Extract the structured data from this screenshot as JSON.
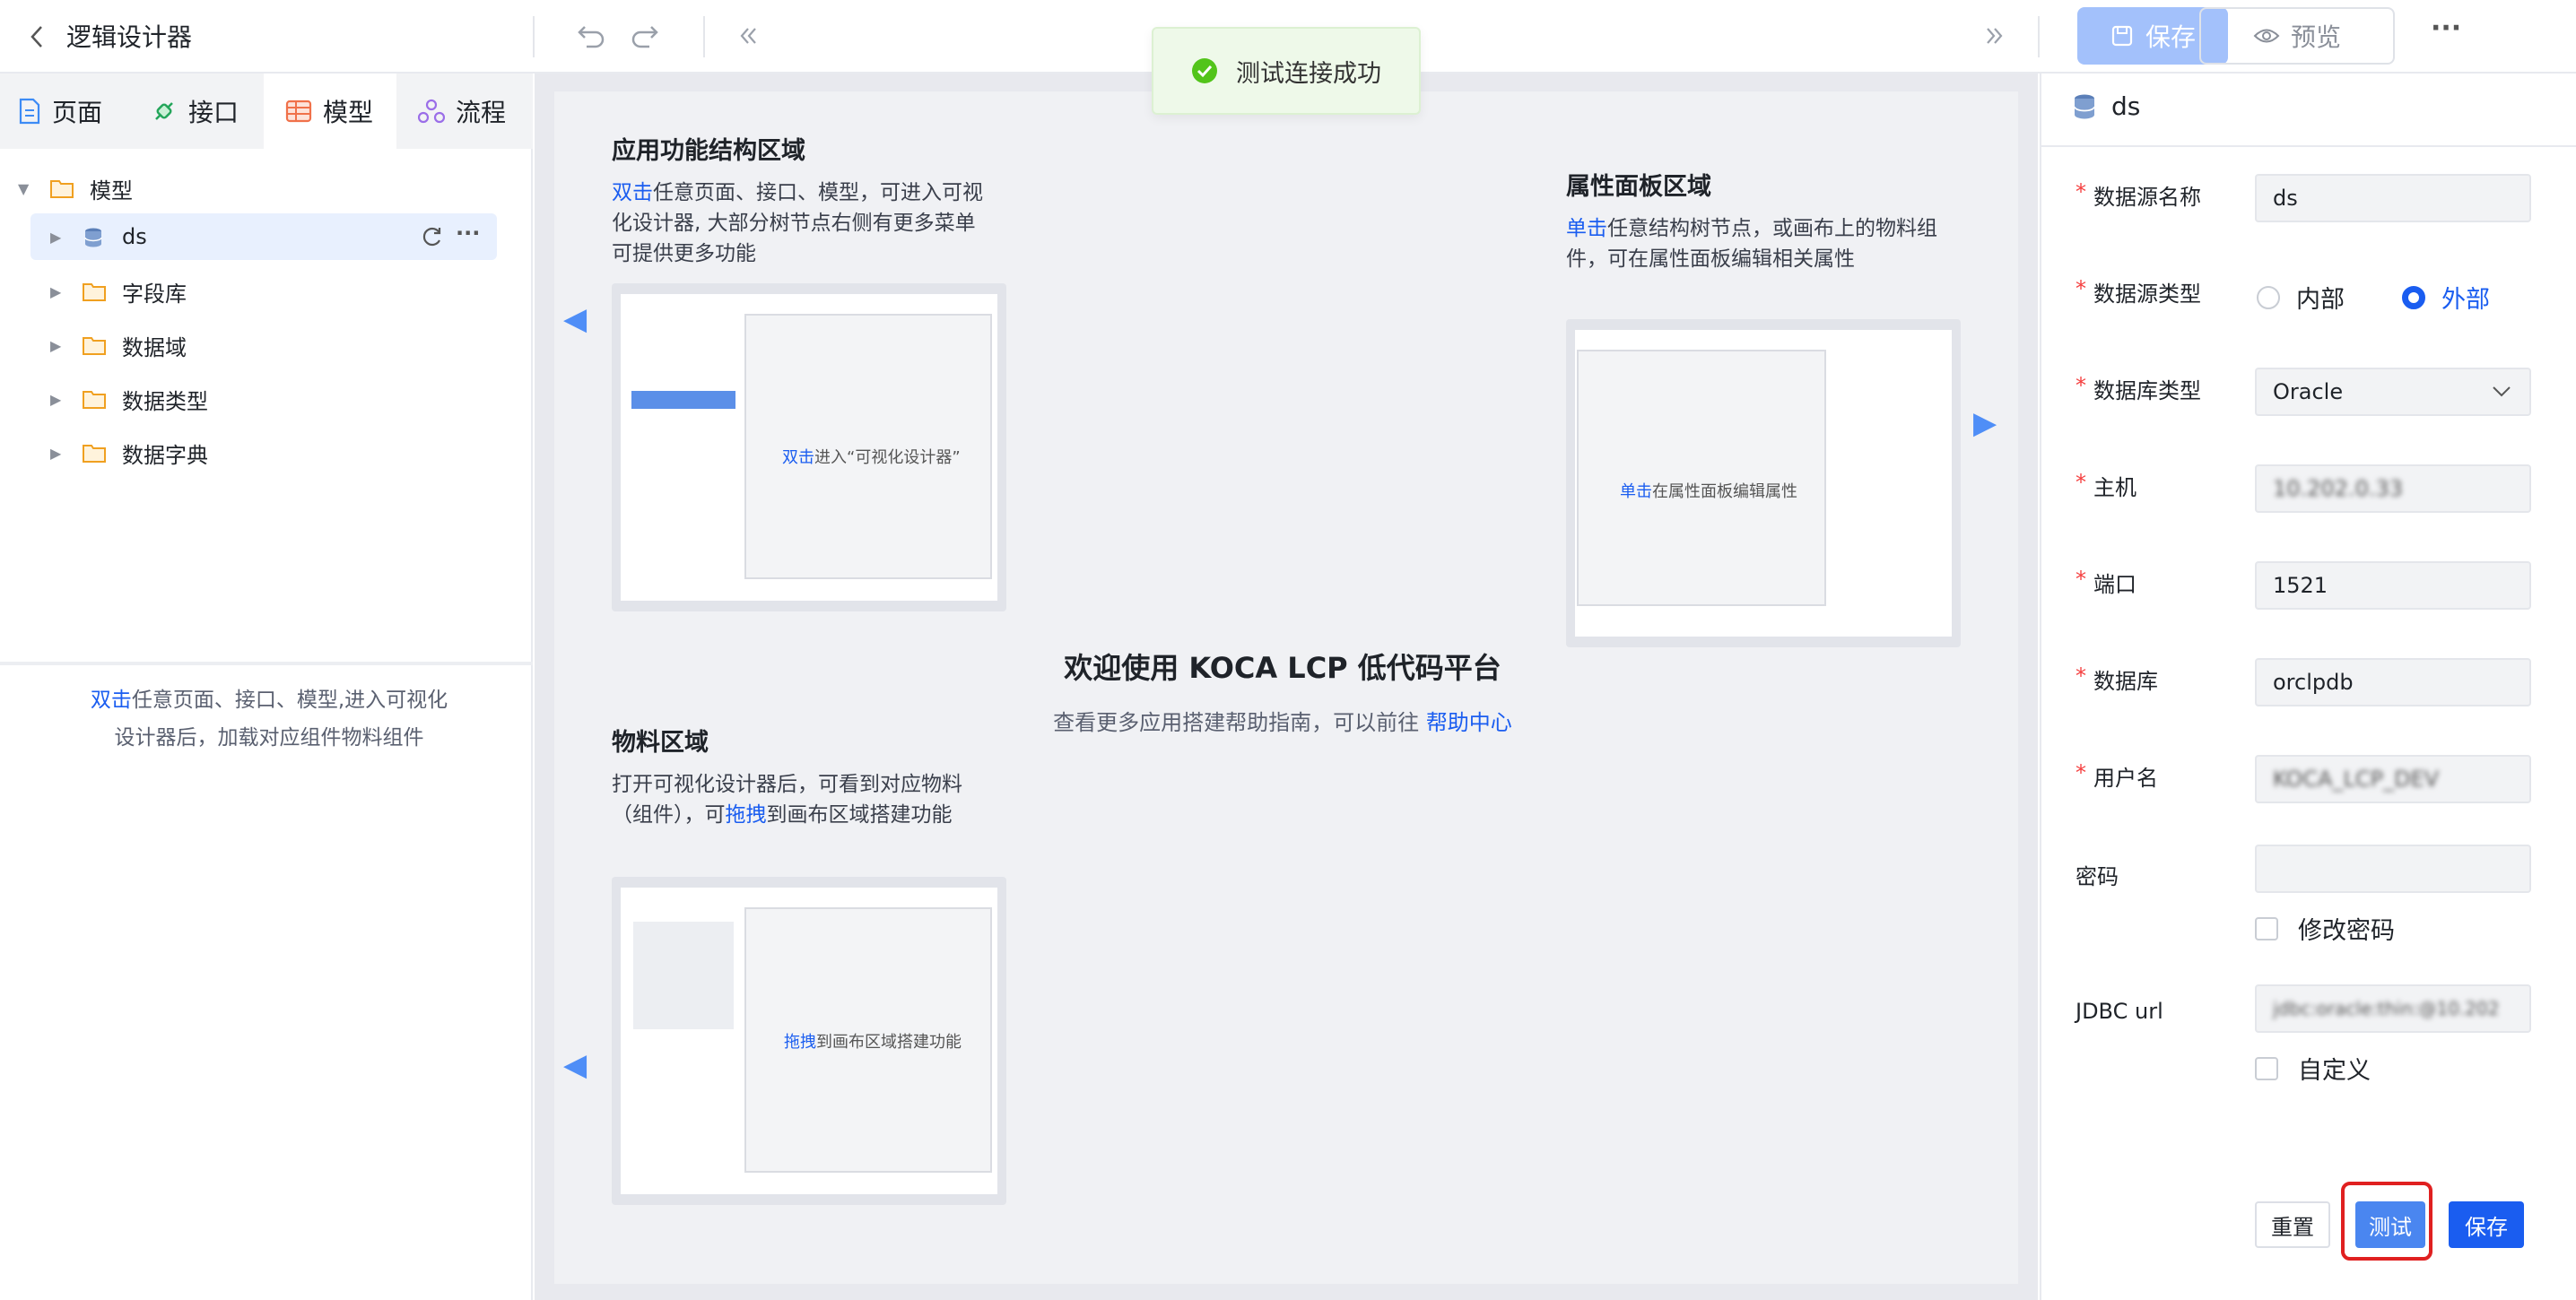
{
  "topbar": {
    "title": "逻辑设计器",
    "save_label": "保存",
    "preview_label": "预览",
    "more_label": "···",
    "icons": [
      "back-chevron-icon",
      "undo-icon",
      "redo-icon",
      "collapse-left-icon",
      "collapse-right-icon",
      "save-icon",
      "eye-icon"
    ]
  },
  "toast": {
    "text": "测试连接成功",
    "color": "#52c41a"
  },
  "left": {
    "tabs": [
      {
        "label": "页面",
        "icon": "page-icon"
      },
      {
        "label": "接口",
        "icon": "api-icon"
      },
      {
        "label": "模型",
        "icon": "model-icon",
        "active": true
      },
      {
        "label": "流程",
        "icon": "flow-icon"
      }
    ],
    "tree": {
      "root": "模型",
      "items": [
        {
          "label": "ds",
          "icon": "database-icon",
          "selected": true
        },
        {
          "label": "字段库",
          "icon": "folder-icon"
        },
        {
          "label": "数据域",
          "icon": "folder-icon"
        },
        {
          "label": "数据类型",
          "icon": "folder-icon"
        },
        {
          "label": "数据字典",
          "icon": "folder-icon"
        }
      ]
    },
    "hint_link": "双击",
    "hint_line1": "任意页面、接口、模型,进入可视化",
    "hint_line2": "设计器后，加载对应组件物料组件"
  },
  "center": {
    "struct_title": "应用功能结构区域",
    "struct_link": "双击",
    "struct_text1": "任意页面、接口、模型，可进入可视",
    "struct_text2": "化设计器, 大部分树节点右侧有更多菜单",
    "struct_text3": "可提供更多功能",
    "struct_mock_link": "双击",
    "struct_mock_text": "进入“可视化设计器”",
    "prop_title": "属性面板区域",
    "prop_link": "单击",
    "prop_text1": "任意结构树节点，或画布上的物料组",
    "prop_text2": "件，可在属性面板编辑相关属性",
    "prop_mock_link": "单击",
    "prop_mock_text": "在属性面板编辑属性",
    "material_title": "物料区域",
    "material_text1": "打开可视化设计器后，可看到对应物料",
    "material_text2a": "（组件），可",
    "material_link": "拖拽",
    "material_text2b": "到画布区域搭建功能",
    "material_mock_link": "拖拽",
    "material_mock_text": "到画布区域搭建功能",
    "welcome_title": "欢迎使用 KOCA LCP 低代码平台",
    "welcome_sub": "查看更多应用搭建帮助指南，可以前往 ",
    "help_link": "帮助中心"
  },
  "right": {
    "header": "ds",
    "fields": [
      {
        "label": "数据源名称",
        "required": true,
        "value": "ds"
      },
      {
        "label": "数据源类型",
        "required": true,
        "options": [
          "内部",
          "外部"
        ],
        "selected": "外部"
      },
      {
        "label": "数据库类型",
        "required": true,
        "value": "Oracle"
      },
      {
        "label": "主机",
        "required": true,
        "value": "10.202.0.33"
      },
      {
        "label": "端口",
        "required": true,
        "value": "1521"
      },
      {
        "label": "数据库",
        "required": true,
        "value": "orclpdb"
      },
      {
        "label": "用户名",
        "required": true,
        "value": "KOCA_LCP_DEV"
      },
      {
        "label": "密码",
        "required": false,
        "value": ""
      },
      {
        "label": "JDBC url",
        "required": false,
        "value": "jdbc:oracle:thin:@10.202"
      }
    ],
    "change_password": "修改密码",
    "custom": "自定义",
    "reset_label": "重置",
    "test_label": "测试",
    "save_label": "保存",
    "accent": "#1a5df0",
    "highlight": "#e02020"
  }
}
